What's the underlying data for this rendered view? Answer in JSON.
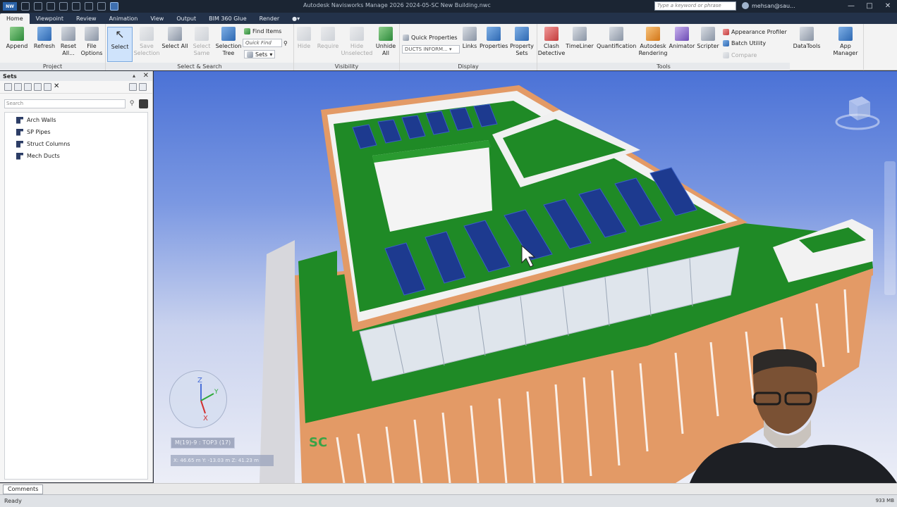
{
  "titlebar": {
    "logo_text": "NW",
    "title": "Autodesk Navisworks Manage 2026    2024-05-SC New Building.nwc",
    "search_placeholder": "Type a keyword or phrase",
    "user": "mehsan@sau..."
  },
  "tabs": [
    "Home",
    "Viewpoint",
    "Review",
    "Animation",
    "View",
    "Output",
    "BIM 360 Glue",
    "Render"
  ],
  "ribbon": {
    "project": {
      "title": "Project",
      "buttons": [
        "Append",
        "Refresh",
        "Reset All...",
        "File Options"
      ]
    },
    "select_search": {
      "title": "Select & Search",
      "select": "Select",
      "save_selection": "Save Selection",
      "select_all": "Select All",
      "select_same": "Select Same",
      "selection_tree": "Selection Tree",
      "find_items": "Find Items",
      "quick_find_placeholder": "Quick Find",
      "sets": "Sets"
    },
    "visibility": {
      "title": "Visibility",
      "buttons": [
        "Hide",
        "Require",
        "Hide Unselected",
        "Unhide All"
      ]
    },
    "display": {
      "title": "Display",
      "quick_properties": "Quick Properties",
      "dropdown_value": "DUCTS INFORM...",
      "buttons": [
        "Links",
        "Properties",
        "Property Sets"
      ]
    },
    "tools": {
      "title": "Tools",
      "buttons": [
        "Clash Detective",
        "TimeLiner",
        "Quantification",
        "Autodesk Rendering",
        "Animator",
        "Scripter"
      ],
      "small": [
        "Appearance Profiler",
        "Batch Utility",
        "Compare"
      ]
    },
    "extra": [
      "DataTools",
      "App Manager"
    ]
  },
  "sets_panel": {
    "title": "Sets",
    "search_placeholder": "Search",
    "items": [
      "Arch Walls",
      "SP Pipes",
      "Struct Columns",
      "Mech Ducts"
    ]
  },
  "viewport": {
    "axis_labels": {
      "z": "Z",
      "y": "Y",
      "x": "X"
    },
    "section_label": "M(19)-9 : TOP3 (17)",
    "coordinates": "X: 46.65 m  Y: -13.03 m  Z: 41.23 m",
    "sign_text": "SC"
  },
  "comments_tab": "Comments",
  "status": {
    "left": "Ready",
    "memory": "933 MB"
  },
  "colors": {
    "sky_top": "#4b72d6",
    "roof_green": "#1f8a26",
    "parapet": "#f2f2f2",
    "facade": "#e39a66",
    "solar_panel": "#1d3a8f",
    "ribbon_bg": "#f3f3f3",
    "tab_bar": "#23324a"
  }
}
